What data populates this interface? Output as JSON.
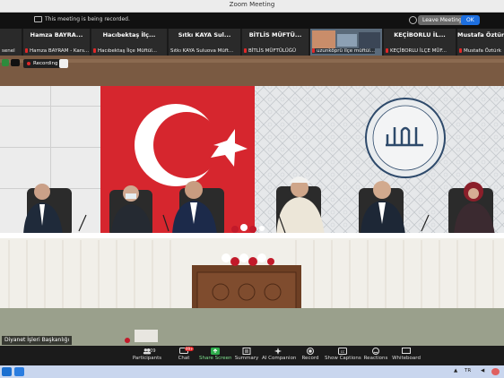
{
  "window": {
    "title": "Zoom Meeting"
  },
  "notice": {
    "text": "This meeting is being recorded.",
    "leave_label": "Leave Meeting",
    "ok_label": "OK"
  },
  "participants_strip": [
    {
      "display": "",
      "name": "senel"
    },
    {
      "display": "Hamza BAYRA...",
      "name": "Hamza BAYRAM - Kars..."
    },
    {
      "display": "Hacıbektaş İlç...",
      "name": "Hacıbektaş İlçe Müftül..."
    },
    {
      "display": "Sıtkı KAYA Sul...",
      "name": "Sıtkı KAYA Suluova Müft..."
    },
    {
      "display": "BİTLİS MÜFTÜ...",
      "name": "BİTLİS MÜFTÜLÜĞÜ"
    },
    {
      "display": "",
      "name": "uzunköprü ilçe müftül..."
    },
    {
      "display": "KEÇİBORLU İL...",
      "name": "KEÇİBORLU İLÇE MÜF..."
    },
    {
      "display": "Mustafa Öztürk",
      "name": "Mustafa Öztürk"
    }
  ],
  "recording_badge": "Recording",
  "video": {
    "speaker_name": "Diyanet İşleri Başkanlığı"
  },
  "toolbar": {
    "participants_count": "909",
    "participants_label": "Participants",
    "chat_label": "Chat",
    "share_label": "Share Screen",
    "summary_label": "Summary",
    "companion_label": "AI Companion",
    "record_label": "Record",
    "captions_label": "Show Captions",
    "reactions_label": "Reactions",
    "whiteboard_label": "Whiteboard",
    "chat_badge": "99+"
  },
  "taskbar": {
    "lang": "TR"
  },
  "colors": {
    "accent": "#1d6fe0",
    "recording": "#e02828",
    "flag_red": "#d6262e",
    "share_green": "#2fae4c"
  }
}
